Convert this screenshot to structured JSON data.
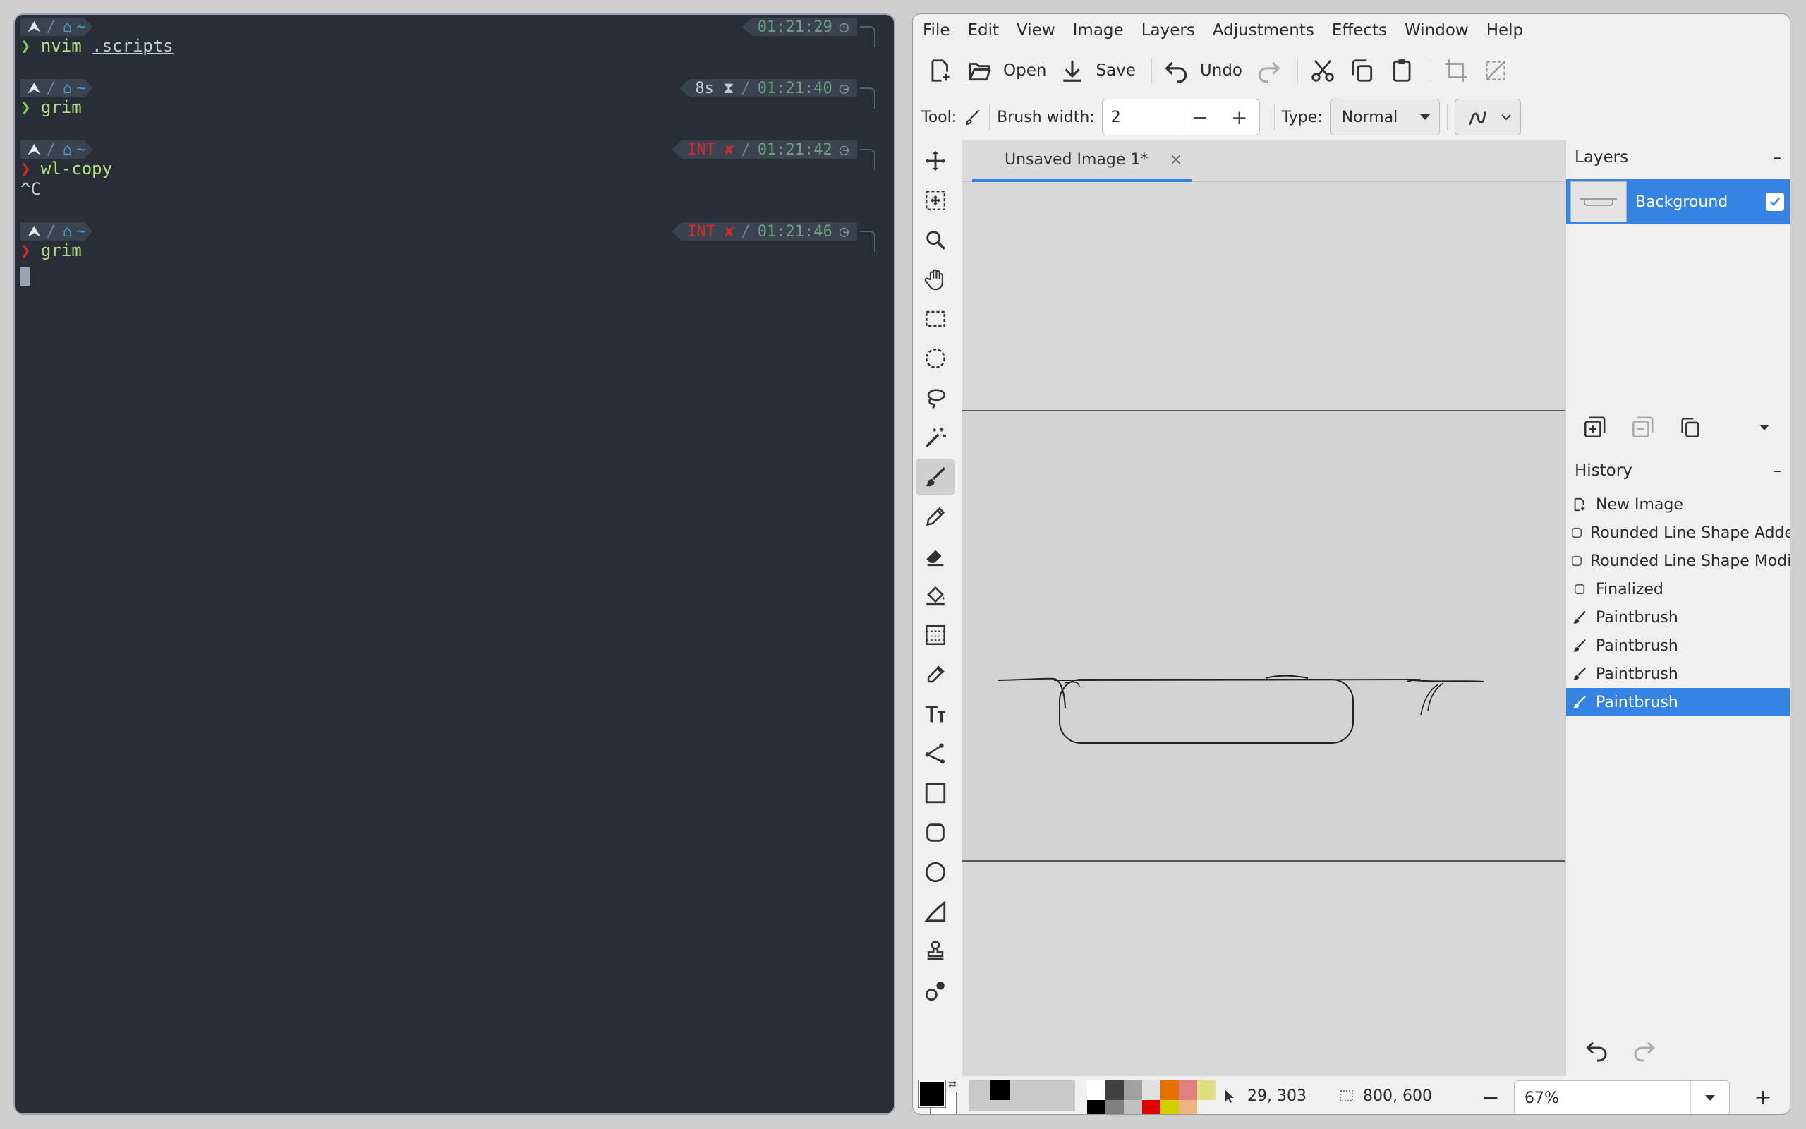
{
  "terminal": {
    "blocks": [
      {
        "command": "nvim",
        "arg": ".scripts",
        "time": "01:21:29",
        "duration": "",
        "status": "",
        "chevron": "green",
        "output": ""
      },
      {
        "command": "grim",
        "arg": "",
        "time": "01:21:40",
        "duration": "8s",
        "status": "",
        "chevron": "green",
        "output": ""
      },
      {
        "command": "wl-copy",
        "arg": "",
        "time": "01:21:42",
        "duration": "",
        "status": "INT ✘",
        "chevron": "red",
        "output": "^C"
      },
      {
        "command": "grim",
        "arg": "",
        "time": "01:21:46",
        "duration": "",
        "status": "INT ✘",
        "chevron": "red",
        "output": ""
      }
    ],
    "prompt_tilde": "~",
    "prompt_char": "❯"
  },
  "pinta": {
    "menu": [
      "File",
      "Edit",
      "View",
      "Image",
      "Layers",
      "Adjustments",
      "Effects",
      "Window",
      "Help"
    ],
    "toolbar": {
      "open": "Open",
      "save": "Save",
      "undo": "Undo"
    },
    "tool_label": "Tool:",
    "brush_width_label": "Brush width:",
    "brush_width": "2",
    "type_label": "Type:",
    "type_value": "Normal",
    "tab_title": "Unsaved Image 1*",
    "layers": {
      "title": "Layers",
      "items": [
        {
          "name": "Background",
          "visible": true
        }
      ]
    },
    "history": {
      "title": "History",
      "items": [
        "New Image",
        "Rounded Line Shape Added",
        "Rounded Line Shape Modified",
        "Finalized",
        "Paintbrush",
        "Paintbrush",
        "Paintbrush",
        "Paintbrush"
      ],
      "selected_index": 7
    },
    "status": {
      "cursor": "29, 303",
      "size": "800, 600",
      "zoom": "67%"
    },
    "palette": [
      "#ffffff",
      "#000000",
      "#404040",
      "#808080",
      "#a0a0a0",
      "#c0c0c0",
      "#e0e0e0",
      "#e00000",
      "#e87000",
      "#d0d000",
      "#e08080",
      "#f0b080",
      "#e0e080"
    ]
  }
}
